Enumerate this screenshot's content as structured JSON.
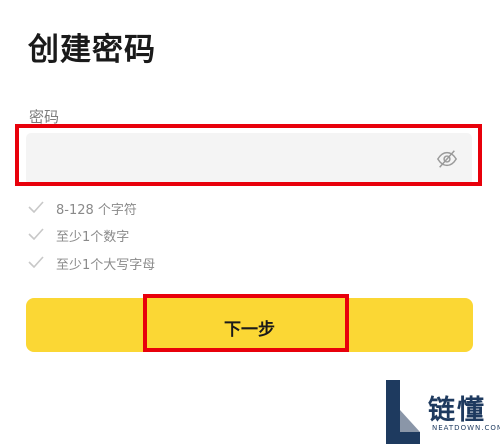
{
  "page": {
    "title": "创建密码"
  },
  "password_field": {
    "label": "密码",
    "value": "",
    "placeholder": ""
  },
  "rules": [
    {
      "text": "8-128 个字符"
    },
    {
      "text": "至少1个数字"
    },
    {
      "text": "至少1个大写字母"
    }
  ],
  "next_button": {
    "label": "下一步"
  },
  "watermark": {
    "cn": "链懂",
    "en": "NEATDOWN.COM"
  },
  "colors": {
    "accent": "#fbd734",
    "annotation": "#e8000b",
    "input_bg": "#f4f4f4",
    "muted_text": "#8a8a8a"
  }
}
